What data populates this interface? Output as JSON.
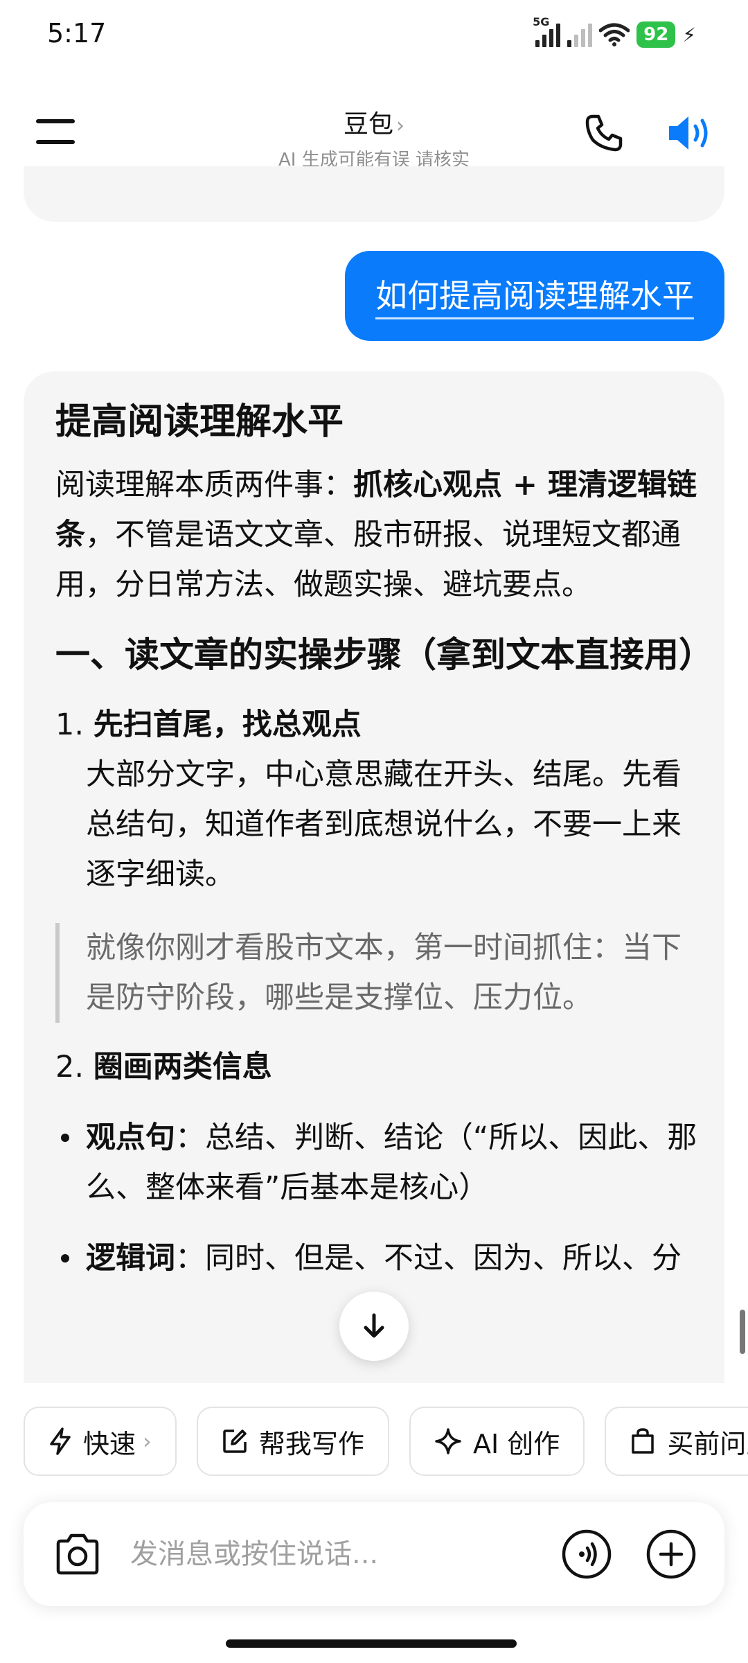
{
  "status_bar": {
    "time": "5:17",
    "network_tag": "5G",
    "battery_level": "92",
    "battery_color": "#2fc24a"
  },
  "header": {
    "title": "豆包",
    "title_chevron": "›",
    "subtitle": "AI 生成可能有误 请核实",
    "menu_icon": "hamburger-menu-icon",
    "phone_icon": "phone-icon",
    "speaker_icon": "speaker-icon"
  },
  "chat": {
    "user_message": "如何提高阅读理解水平",
    "user_bubble_color": "#0a7cfb",
    "answer": {
      "title": "提高阅读理解水平",
      "intro_prefix": "阅读理解本质两件事：",
      "intro_bold": "抓核心观点 + 理清逻辑链条",
      "intro_suffix": "，不管是语文文章、股市研报、说理短文都通用，分日常方法、做题实操、避坑要点。",
      "section1_title": "一、读文章的实操步骤（拿到文本直接用）",
      "step1_num": "1. ",
      "step1_title": "先扫首尾，找总观点",
      "step1_body": "大部分文字，中心意思藏在开头、结尾。先看总结句，知道作者到底想说什么，不要一上来逐字细读。",
      "quote": "就像你刚才看股市文本，第一时间抓住：当下是防守阶段，哪些是支撑位、压力位。",
      "step2_num": "2. ",
      "step2_title": "圈画两类信息",
      "bullet1_bold": "观点句",
      "bullet1_text": "：总结、判断、结论（“所以、因此、那么、整体来看”后基本是核心）",
      "bullet2_bold": "逻辑词",
      "bullet2_text": "：同时、但是、不过、因为、所以、分"
    }
  },
  "quick_actions": [
    {
      "label": "快速",
      "icon": "lightning-icon",
      "chevron": "›"
    },
    {
      "label": "帮我写作",
      "icon": "edit-icon"
    },
    {
      "label": "AI 创作",
      "icon": "sparkle-icon"
    },
    {
      "label": "买前问豆包",
      "icon": "shopping-bag-icon"
    }
  ],
  "composer": {
    "placeholder": "发消息或按住说话...",
    "camera_icon": "camera-icon",
    "voice_icon": "voice-call-icon",
    "plus_icon": "plus-icon"
  },
  "icons": {
    "scroll_down": "arrow-down-icon"
  }
}
